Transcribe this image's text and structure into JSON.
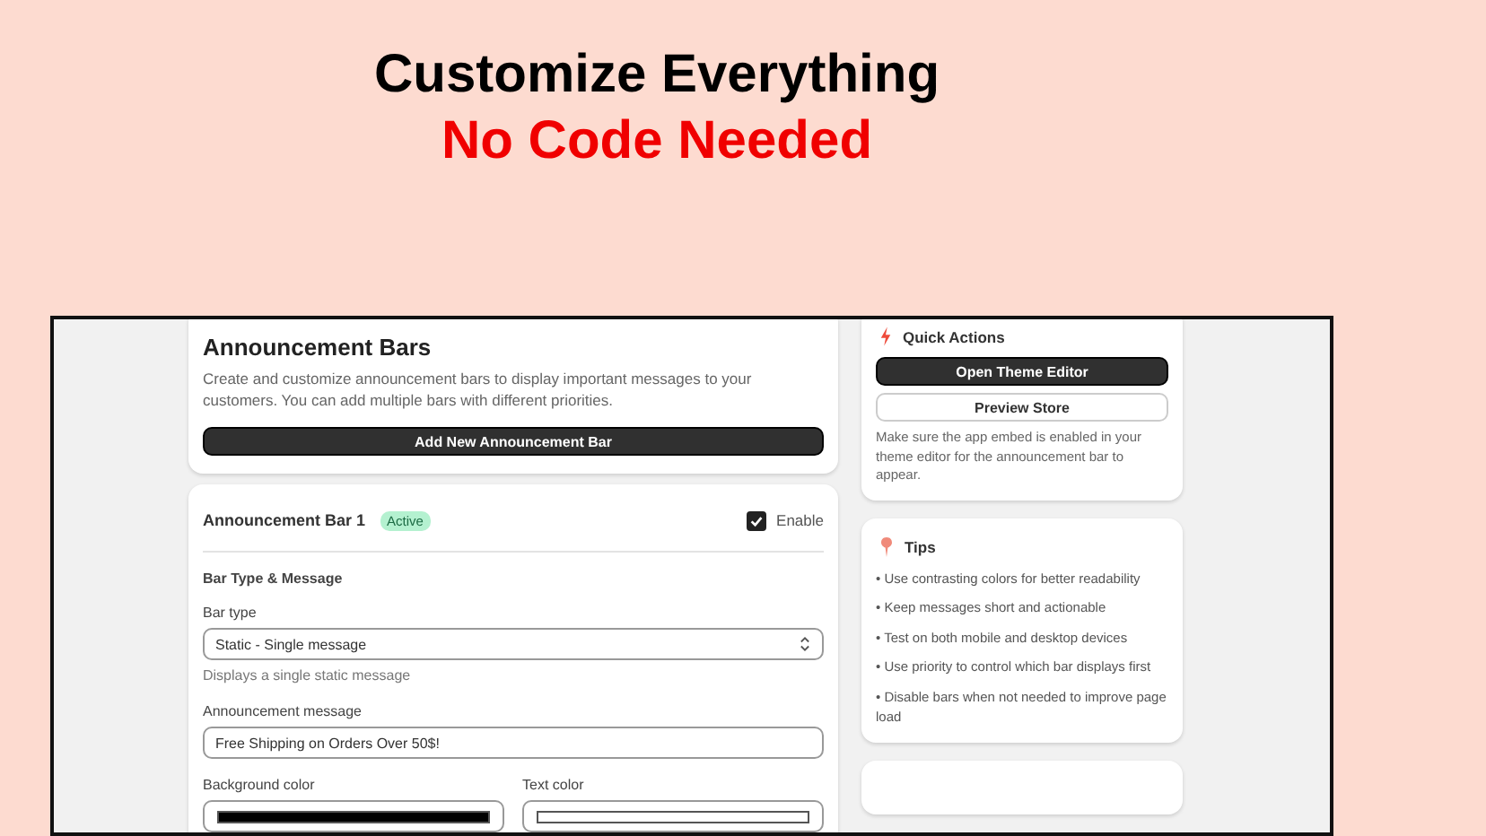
{
  "headline": {
    "title": "Customize Everything",
    "subtitle": "No Code Needed"
  },
  "main": {
    "intro": {
      "title": "Announcement Bars",
      "description": "Create and customize announcement bars to display important messages to your customers. You can add multiple bars with different priorities.",
      "button": "Add New Announcement Bar"
    },
    "bar": {
      "title": "Announcement Bar 1",
      "badge": "Active",
      "enable": {
        "label": "Enable",
        "checked": true
      },
      "section": "Bar Type & Message",
      "bar_type": {
        "label": "Bar type",
        "value": "Static - Single message",
        "help": "Displays a single static message"
      },
      "message": {
        "label": "Announcement message",
        "value": "Free Shipping on Orders Over 50$!"
      },
      "color_fields": [
        {
          "label": "Background color",
          "color": "#000000"
        },
        {
          "label": "Text color",
          "color": "#ffffff"
        }
      ]
    }
  },
  "sidebar": {
    "quick_actions": {
      "title": "Quick Actions",
      "buttons": [
        {
          "label": "Open Theme Editor",
          "kind": "primary"
        },
        {
          "label": "Preview Store",
          "kind": "secondary"
        }
      ],
      "note": "Make sure the app embed is enabled in your theme editor for the announcement bar to appear."
    },
    "tips": {
      "title": "Tips",
      "items": [
        "• Use contrasting colors for better readability",
        "• Keep messages short and actionable",
        "• Test on both mobile and desktop devices",
        "• Use priority to control which bar displays first",
        "• Disable bars when not needed to improve page load"
      ]
    }
  }
}
